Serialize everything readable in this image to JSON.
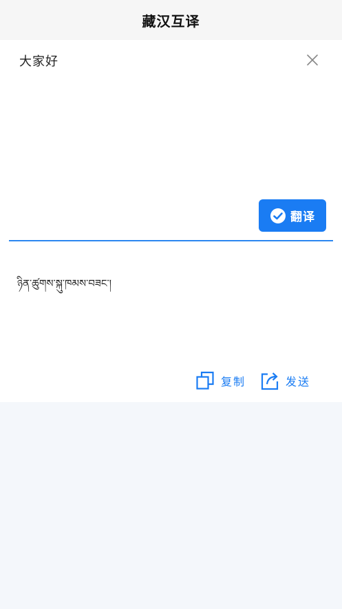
{
  "header": {
    "title": "藏汉互译"
  },
  "input": {
    "text": "大家好"
  },
  "translate_button": {
    "label": "翻译"
  },
  "result": {
    "text": "ཉིན་ཚུགས་སྐུ་ཁམས་བཟང་།"
  },
  "actions": {
    "copy_label": "复制",
    "send_label": "发送"
  },
  "colors": {
    "accent": "#1a7cf3",
    "divider": "#2b86f0",
    "background": "#f4f7fb",
    "header_bg": "#f6f6f6",
    "panel_bg": "#ffffff"
  },
  "icons": [
    "close-icon",
    "check-circle-icon",
    "copy-icon",
    "share-icon"
  ]
}
